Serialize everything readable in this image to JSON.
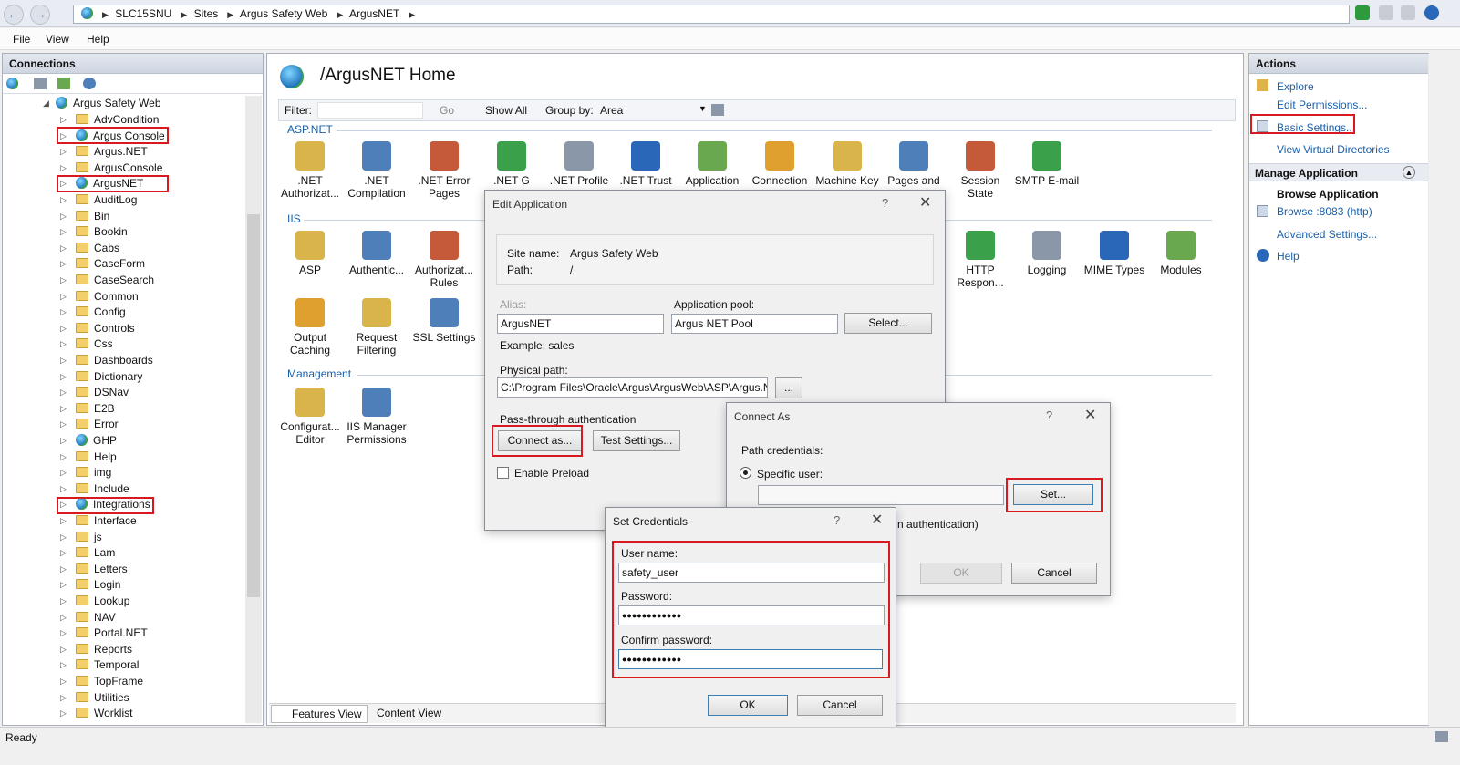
{
  "address_bar": {
    "crumbs": [
      "SLC15SNU",
      "Sites",
      "Argus Safety Web",
      "ArgusNET"
    ]
  },
  "menu": {
    "file": "File",
    "view": "View",
    "help": "Help"
  },
  "connections": {
    "title": "Connections",
    "root": "Argus Safety Web",
    "items": [
      "AdvCondition",
      "Argus Console",
      "Argus.NET",
      "ArgusConsole",
      "ArgusNET",
      "AuditLog",
      "Bin",
      "Bookin",
      "Cabs",
      "CaseForm",
      "CaseSearch",
      "Common",
      "Config",
      "Controls",
      "Css",
      "Dashboards",
      "Dictionary",
      "DSNav",
      "E2B",
      "Error",
      "GHP",
      "Help",
      "img",
      "Include",
      "Integrations",
      "Interface",
      "js",
      "Lam",
      "Letters",
      "Login",
      "Lookup",
      "NAV",
      "Portal.NET",
      "Reports",
      "Temporal",
      "TopFrame",
      "Utilities",
      "Worklist"
    ]
  },
  "home": {
    "title": "/ArgusNET Home",
    "filter_label": "Filter:",
    "go": "Go",
    "show_all": "Show All",
    "group_by_label": "Group by:",
    "group_by_value": "Area",
    "groups": {
      "aspnet": "ASP.NET",
      "iis": "IIS",
      "management": "Management"
    },
    "aspnet_features": [
      ".NET Authorizat...",
      ".NET Compilation",
      ".NET Error Pages",
      ".NET G",
      ".NET Profile",
      ".NET Trust",
      "Application",
      "Connection",
      "Machine Key",
      "Pages and",
      "Session State",
      "SMTP E-mail"
    ],
    "iis_features": [
      "ASP",
      "Authentic...",
      "Authorizat... Rules",
      "HTTP Respon...",
      "Logging",
      "MIME Types",
      "Modules",
      "Output Caching",
      "Request Filtering",
      "SSL Settings"
    ],
    "management_features": [
      "Configurat... Editor",
      "IIS Manager Permissions"
    ],
    "features_view": "Features View",
    "content_view": "Content View"
  },
  "actions": {
    "title": "Actions",
    "explore": "Explore",
    "edit_permissions": "Edit Permissions...",
    "basic_settings": "Basic Settings...",
    "view_virtual_dirs": "View Virtual Directories",
    "manage_app": "Manage Application",
    "browse_app": "Browse Application",
    "browse_8083": "Browse :8083 (http)",
    "advanced_settings": "Advanced Settings...",
    "help": "Help"
  },
  "edit_app": {
    "title": "Edit Application",
    "site_name_label": "Site name:",
    "site_name": "Argus Safety Web",
    "path_label": "Path:",
    "path": "/",
    "alias_label": "Alias:",
    "alias": "ArgusNET",
    "app_pool_label": "Application pool:",
    "app_pool": "Argus NET Pool",
    "select": "Select...",
    "example": "Example: sales",
    "physical_path_label": "Physical path:",
    "physical_path": "C:\\Program Files\\Oracle\\Argus\\ArgusWeb\\ASP\\Argus.N",
    "browse": "...",
    "passthrough": "Pass-through authentication",
    "connect_as": "Connect as...",
    "test_settings": "Test Settings...",
    "enable_preload": "Enable Preload"
  },
  "connect_as": {
    "title": "Connect As",
    "path_credentials": "Path credentials:",
    "specific_user": "Specific user:",
    "set": "Set...",
    "app_user_tail": "n authentication)",
    "ok": "OK",
    "cancel": "Cancel"
  },
  "set_credentials": {
    "title": "Set Credentials",
    "username_label": "User name:",
    "username": "safety_user",
    "password_label": "Password:",
    "password": "●●●●●●●●●●●●",
    "confirm_label": "Confirm password:",
    "confirm": "●●●●●●●●●●●●",
    "ok": "OK",
    "cancel": "Cancel"
  },
  "status": {
    "text": "Ready"
  },
  "colors": {
    "highlight": "#d71920",
    "link": "#1a5fa8"
  }
}
